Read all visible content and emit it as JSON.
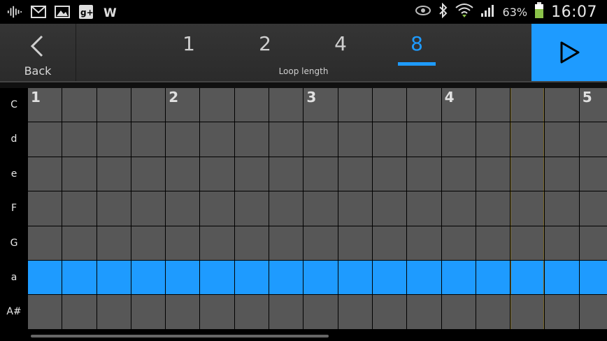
{
  "status_bar": {
    "battery_percent": "63%",
    "time": "16:07",
    "left_icons": [
      "sound-wave-icon",
      "gmail-icon",
      "gallery-icon",
      "google-plus-icon",
      "wordpress-icon"
    ],
    "right_icons": [
      "eye-icon",
      "bluetooth-icon",
      "wifi-icon",
      "signal-icon",
      "battery-icon"
    ]
  },
  "toolbar": {
    "back_label": "Back",
    "loop_label": "Loop length",
    "loop_options": [
      "1",
      "2",
      "4",
      "8"
    ],
    "selected_loop": "8"
  },
  "grid": {
    "notes": [
      "C",
      "d",
      "e",
      "F",
      "G",
      "a",
      "A#"
    ],
    "beat_numbers": [
      "1",
      "2",
      "3",
      "4",
      "5"
    ],
    "highlight_row": 5,
    "current_column": 14
  },
  "colors": {
    "accent": "#1e9bff",
    "cell": "#575757"
  }
}
